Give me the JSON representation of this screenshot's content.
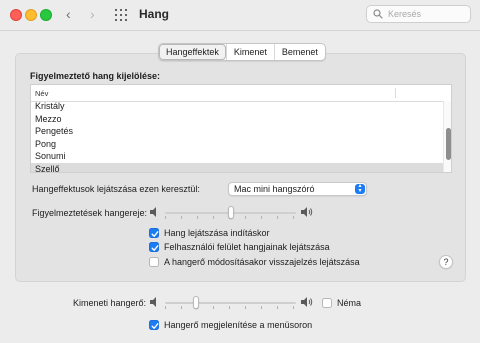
{
  "window": {
    "title": "Hang",
    "search_placeholder": "Keresés"
  },
  "tabs": [
    {
      "label": "Hangeffektek",
      "active": true
    },
    {
      "label": "Kimenet",
      "active": false
    },
    {
      "label": "Bemenet",
      "active": false
    }
  ],
  "alert": {
    "section_label": "Figyelmeztető hang kijelölése:",
    "column_header": "Név",
    "sounds": [
      "Kristály",
      "Mezzo",
      "Pengetés",
      "Pong",
      "Sonumi",
      "Szellő"
    ],
    "selected": "Szellő"
  },
  "effects_output": {
    "label": "Hangeffektusok lejátszása ezen keresztül:",
    "value": "Mac mini hangszóró"
  },
  "alert_volume": {
    "label": "Figyelmeztetések hangereje:",
    "level": 0.5
  },
  "options": [
    {
      "label": "Hang lejátszása indításkor",
      "checked": true
    },
    {
      "label": "Felhasználói felület hangjainak lejátszása",
      "checked": true
    },
    {
      "label": "A hangerő módosításakor visszajelzés lejátszása",
      "checked": false
    }
  ],
  "help_label": "?",
  "output_volume": {
    "label": "Kimeneti hangerő:",
    "level": 0.22,
    "mute_label": "Néma",
    "mute_checked": false
  },
  "menubar_option": {
    "label": "Hangerő megjelenítése a menüsoron",
    "checked": true
  },
  "colors": {
    "accent": "#1b7cf4",
    "window_bg": "#ececec",
    "panel_bg": "#e3e3e3",
    "selected_row": "#dcdcdc"
  }
}
